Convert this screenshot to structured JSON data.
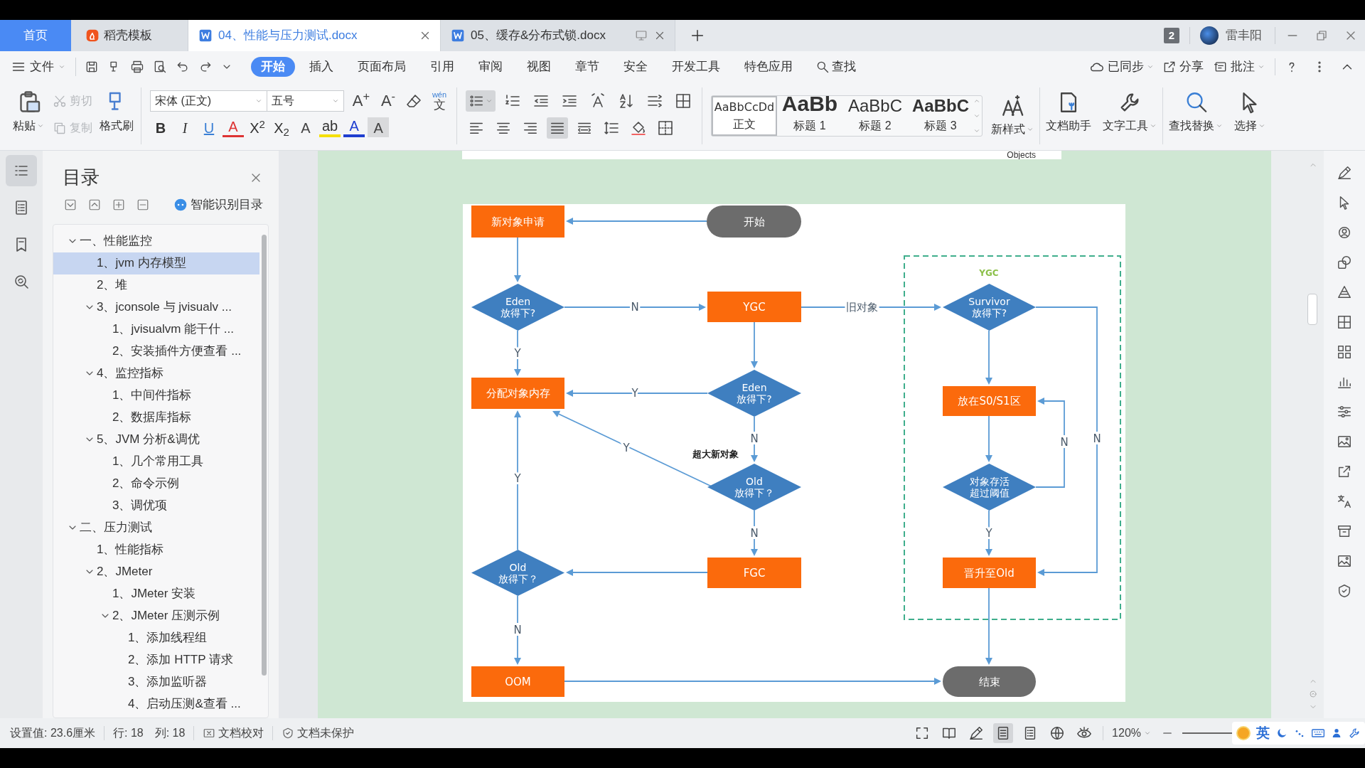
{
  "tabs": [
    {
      "kind": "home",
      "label": "首页",
      "selected": false
    },
    {
      "kind": "docer",
      "label": "稻壳模板",
      "selected": false
    },
    {
      "kind": "doc",
      "label": "04、性能与压力测试.docx",
      "selected": true
    },
    {
      "kind": "doc",
      "label": "05、缓存&分布式锁.docx",
      "selected": false
    }
  ],
  "tab_count": "2",
  "user": "雷丰阳",
  "menu": {
    "file": "文件",
    "tabs": [
      {
        "label": "开始",
        "selected": true
      },
      {
        "label": "插入",
        "selected": false
      },
      {
        "label": "页面布局",
        "selected": false
      },
      {
        "label": "引用",
        "selected": false
      },
      {
        "label": "审阅",
        "selected": false
      },
      {
        "label": "视图",
        "selected": false
      },
      {
        "label": "章节",
        "selected": false
      },
      {
        "label": "安全",
        "selected": false
      },
      {
        "label": "开发工具",
        "selected": false
      },
      {
        "label": "特色应用",
        "selected": false
      }
    ],
    "search": "查找",
    "sync": "已同步",
    "share": "分享",
    "comment": "批注"
  },
  "ribbon": {
    "paste": "粘贴",
    "cut": {
      "label": "剪切",
      "disabled": true
    },
    "copy": {
      "label": "复制",
      "disabled": true
    },
    "format_painter": "格式刷",
    "font": "宋体 (正文)",
    "size": "五号",
    "font_buttons": [
      "A$^{+}$",
      "A$^{-}$"
    ],
    "phonetic": {
      "top": "wén",
      "bottom": "文"
    },
    "format_buttons": [
      {
        "kind": "bold",
        "text": "B"
      },
      {
        "kind": "italic",
        "text": "I"
      },
      {
        "kind": "underline",
        "text": "U"
      },
      {
        "kind": "strike",
        "text": "A"
      },
      {
        "kind": "sup",
        "text": "X$^{2}$"
      },
      {
        "kind": "sub",
        "text": "X$_{2}$"
      },
      {
        "kind": "effect",
        "text": "A"
      },
      {
        "kind": "highlight",
        "text": "ab"
      },
      {
        "kind": "color",
        "text": "A"
      },
      {
        "kind": "shade",
        "text": "A"
      }
    ],
    "bullet_list_on": true,
    "alignments": [
      {
        "kind": "left",
        "selected": false
      },
      {
        "kind": "center",
        "selected": false
      },
      {
        "kind": "right",
        "selected": false
      },
      {
        "kind": "justify",
        "selected": true
      },
      {
        "kind": "distributed",
        "selected": false
      }
    ],
    "styles": [
      {
        "kind": "body",
        "preview": "AaBbCcDd",
        "label": "正文",
        "selected": true
      },
      {
        "kind": "heading1",
        "preview": "AaBb",
        "label": "标题 1",
        "selected": false
      },
      {
        "kind": "heading2",
        "preview": "AaBbC",
        "label": "标题 2",
        "selected": false
      },
      {
        "kind": "heading3",
        "preview": "AaBbC",
        "label": "标题 3",
        "selected": false
      }
    ],
    "new_style": "新样式",
    "tools": [
      "文档助手",
      "文字工具",
      "查找替换",
      "选择"
    ]
  },
  "nav_tabs": [
    {
      "kind": "toc",
      "selected": true
    },
    {
      "kind": "outline",
      "selected": false
    },
    {
      "kind": "bookmark",
      "selected": false
    },
    {
      "kind": "find",
      "selected": false
    }
  ],
  "toc": {
    "title": "目录",
    "smart": "智能识别目录",
    "items": [
      {
        "label": "一、性能监控",
        "selected": false,
        "expanded": true,
        "children": [
          {
            "label": "1、jvm 内存模型",
            "selected": true
          },
          {
            "label": "2、堆",
            "selected": false
          },
          {
            "label": "3、jconsole 与 jvisualv ...",
            "selected": false,
            "expanded": true,
            "children": [
              {
                "label": "1、jvisualvm 能干什 ...",
                "selected": false
              },
              {
                "label": "2、安装插件方便查看 ...",
                "selected": false
              }
            ]
          },
          {
            "label": "4、监控指标",
            "selected": false,
            "expanded": true,
            "children": [
              {
                "label": "1、中间件指标",
                "selected": false
              },
              {
                "label": "2、数据库指标",
                "selected": false
              }
            ]
          },
          {
            "label": "5、JVM 分析&调优",
            "selected": false,
            "expanded": true,
            "children": [
              {
                "label": "1、几个常用工具",
                "selected": false
              },
              {
                "label": "2、命令示例",
                "selected": false
              },
              {
                "label": "3、调优项",
                "selected": false
              }
            ]
          }
        ]
      },
      {
        "label": "二、压力测试",
        "selected": false,
        "expanded": true,
        "children": [
          {
            "label": "1、性能指标",
            "selected": false
          },
          {
            "label": "2、JMeter",
            "selected": false,
            "expanded": true,
            "children": [
              {
                "label": "1、JMeter 安装",
                "selected": false
              },
              {
                "label": "2、JMeter 压测示例",
                "selected": false,
                "expanded": true,
                "children": [
                  {
                    "label": "1、添加线程组",
                    "selected": false
                  },
                  {
                    "label": "2、添加 HTTP 请求",
                    "selected": false
                  },
                  {
                    "label": "3、添加监听器",
                    "selected": false
                  },
                  {
                    "label": "4、启动压测&查看 ...",
                    "selected": false
                  }
                ]
              }
            ]
          }
        ]
      }
    ]
  },
  "document": {
    "top_caption": "Objects",
    "flowchart": {
      "group_label": "YGC",
      "annotation": "超大新对象",
      "nodes": [
        {
          "kind": "process",
          "lines": [
            "新对象申请"
          ]
        },
        {
          "kind": "terminal",
          "lines": [
            "开始"
          ]
        },
        {
          "kind": "decision",
          "lines": [
            "Eden",
            "放得下?"
          ]
        },
        {
          "kind": "process",
          "lines": [
            "YGC"
          ]
        },
        {
          "kind": "decision",
          "lines": [
            "Survivor",
            "放得下?"
          ]
        },
        {
          "kind": "process",
          "lines": [
            "分配对象内存"
          ]
        },
        {
          "kind": "decision",
          "lines": [
            "Eden",
            "放得下?"
          ]
        },
        {
          "kind": "process",
          "lines": [
            "放在S0/S1区"
          ]
        },
        {
          "kind": "decision",
          "lines": [
            "Old",
            "放得下？"
          ]
        },
        {
          "kind": "decision",
          "lines": [
            "对象存活",
            "超过阈值"
          ]
        },
        {
          "kind": "decision",
          "lines": [
            "Old",
            "放得下？"
          ]
        },
        {
          "kind": "process",
          "lines": [
            "FGC"
          ]
        },
        {
          "kind": "process",
          "lines": [
            "晋升至Old"
          ]
        },
        {
          "kind": "process",
          "lines": [
            "OOM"
          ]
        },
        {
          "kind": "terminal",
          "lines": [
            "结束"
          ]
        }
      ],
      "edges": [
        {
          "kind": "arrow"
        },
        {
          "kind": "arrow"
        },
        {
          "kind": "arrow",
          "label": "N"
        },
        {
          "kind": "arrow",
          "label": "Y"
        },
        {
          "kind": "arrow"
        },
        {
          "kind": "arrow",
          "label": "旧对象"
        },
        {
          "kind": "arrow",
          "label": "Y"
        },
        {
          "kind": "arrow",
          "label": "N"
        },
        {
          "kind": "arrow",
          "label": "Y"
        },
        {
          "kind": "arrow",
          "label": "N"
        },
        {
          "kind": "arrow"
        },
        {
          "kind": "arrow",
          "label": "Y"
        },
        {
          "kind": "arrow",
          "label": "N"
        },
        {
          "kind": "arrow"
        },
        {
          "kind": "arrow"
        },
        {
          "kind": "arrow"
        },
        {
          "kind": "arrow",
          "label": "N"
        },
        {
          "kind": "arrow",
          "label": "Y"
        },
        {
          "kind": "arrow",
          "label": "N"
        },
        {
          "kind": "arrow"
        }
      ]
    }
  },
  "status_bar": {
    "position": "设置值: 23.6厘米",
    "line": "行: 18",
    "column": "列: 18",
    "proofread": "文档校对",
    "protection": "文档未保护",
    "views": [
      {
        "kind": "fullscreen",
        "selected": false
      },
      {
        "kind": "reading",
        "selected": false
      },
      {
        "kind": "edit",
        "selected": false
      },
      {
        "kind": "page",
        "selected": true
      },
      {
        "kind": "outline",
        "selected": false
      },
      {
        "kind": "web",
        "selected": false
      },
      {
        "kind": "eye",
        "selected": false
      }
    ],
    "zoom": "120%",
    "ime": "英"
  }
}
